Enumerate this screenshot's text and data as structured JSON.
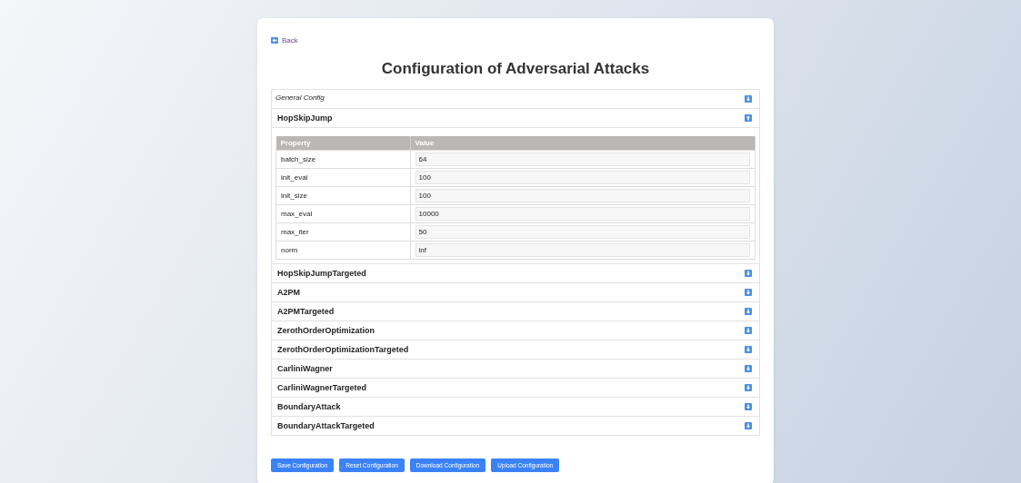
{
  "back_link": "Back",
  "title": "Configuration of Adversarial Attacks",
  "sections": [
    {
      "kind": "general",
      "title": "General Config",
      "expanded": false
    },
    {
      "kind": "attack",
      "title": "HopSkipJump",
      "expanded": true,
      "table": {
        "columns": [
          "Property",
          "Value"
        ],
        "rows": [
          {
            "property": "batch_size",
            "value": "64"
          },
          {
            "property": "init_eval",
            "value": "100"
          },
          {
            "property": "init_size",
            "value": "100"
          },
          {
            "property": "max_eval",
            "value": "10000"
          },
          {
            "property": "max_iter",
            "value": "50"
          },
          {
            "property": "norm",
            "value": "inf"
          }
        ]
      }
    },
    {
      "kind": "attack",
      "title": "HopSkipJumpTargeted",
      "expanded": false
    },
    {
      "kind": "attack",
      "title": "A2PM",
      "expanded": false
    },
    {
      "kind": "attack",
      "title": "A2PMTargeted",
      "expanded": false
    },
    {
      "kind": "attack",
      "title": "ZerothOrderOptimization",
      "expanded": false
    },
    {
      "kind": "attack",
      "title": "ZerothOrderOptimizationTargeted",
      "expanded": false
    },
    {
      "kind": "attack",
      "title": "CarliniWagner",
      "expanded": false
    },
    {
      "kind": "attack",
      "title": "CarliniWagnerTargeted",
      "expanded": false
    },
    {
      "kind": "attack",
      "title": "BoundaryAttack",
      "expanded": false
    },
    {
      "kind": "attack",
      "title": "BoundaryAttackTargeted",
      "expanded": false
    }
  ],
  "buttons": [
    "Save Configuration",
    "Reset Configuration",
    "Download Configuration",
    "Upload Configuration"
  ]
}
